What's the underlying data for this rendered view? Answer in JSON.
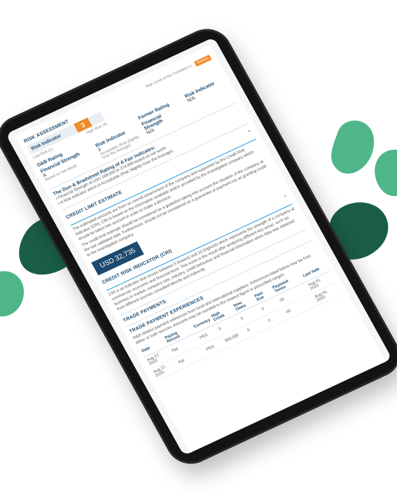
{
  "colors": {
    "brand_dark": "#1d4a6e",
    "risk_orange": "#f08a2c",
    "accent_green": "#4fb68a",
    "deep_green": "#1a5e4a",
    "link_blue": "#1b9ad6"
  },
  "risk": {
    "title": "RISK ASSESSMENT",
    "indicator_label": "Risk Indicator",
    "indicator_value": "3",
    "high_risk_label": "High Risk (4)",
    "low_risk_label": "Low Risk (1)",
    "level_label": "Risk Level of the Company is:",
    "level_badge": "Medium"
  },
  "rating": {
    "former_label": "Former Rating",
    "former_strength_label": "Financial Strength",
    "former_strength_value": "N/A",
    "former_ri_label": "Risk Indicator",
    "former_ri_value": "N/A",
    "db_label": "D&B Rating",
    "fs_label": "Financial Strength",
    "fs_value": "A",
    "fs_note": "Based on Net Worth",
    "ri_label": "Risk Indicator",
    "ri_value": "3",
    "ri_note": "Acceptable (Risk Slightly Over the Average)"
  },
  "fair": {
    "title": "The Dun & Bradstreet Rating of A Fair indicates:",
    "bullet1": "Financial Strength of USD 188,000 to 374,999 based on net worth.",
    "bullet2": "A Risk Indicator which is Acceptable (Risk Slightly Over the Average)."
  },
  "credit_limit": {
    "title": "CREDIT LIMIT ESTIMATE",
    "para1": "The estimated amounts are from an overall assessment of the company and supported by the Credit Risk Indicator (CRI). CRI is based on the information available and/or provided by the investigated company which should be taken into account in order to make a decision.",
    "para2": "The credit limit estimate should be considered as a guideline taking into account the situation of the company at the last validated date. Furthermore, should not be considered as a guarantee of payment nor as granting credit to the investigated company.",
    "amount": "USD 32,735"
  },
  "cri": {
    "title": "CREDIT RISK INDICATOR (CRI)",
    "para": "CRI is an indicator that scores between 0 (lowest) and 10 (highest) which represents the strength of a company at commercial, economic and financial level. This score is the result after analyzing different key areas, such as: business in market, company size, industry, credit behaviour and financial information when data was obtained from different sources consulted directly and indirectly."
  },
  "trade": {
    "title": "TRADE PAYMENTS",
    "sub_title": "TRADE PAYMENT EXPERIENCES",
    "para": "D&B obtains payment references from local and international suppliers. References listed below may be from either or both sources. Amounts may be rounded to the nearest figure in prescribed ranges.",
    "headers": [
      "Date",
      "Paying Record",
      "Currency",
      "High Credit",
      "Now Owes",
      "Past Due",
      "Payment Terms",
      "Last Sale"
    ],
    "rows": [
      [
        "Aug 27, 2020",
        "Ppt",
        "PES",
        "0",
        "0",
        "0",
        "30",
        "Aug 01, 2020"
      ],
      [
        "Aug 27, 2020",
        "Ppt",
        "PES",
        "600,000",
        "0",
        "0",
        "45",
        "Aug 01, 2020"
      ]
    ]
  }
}
